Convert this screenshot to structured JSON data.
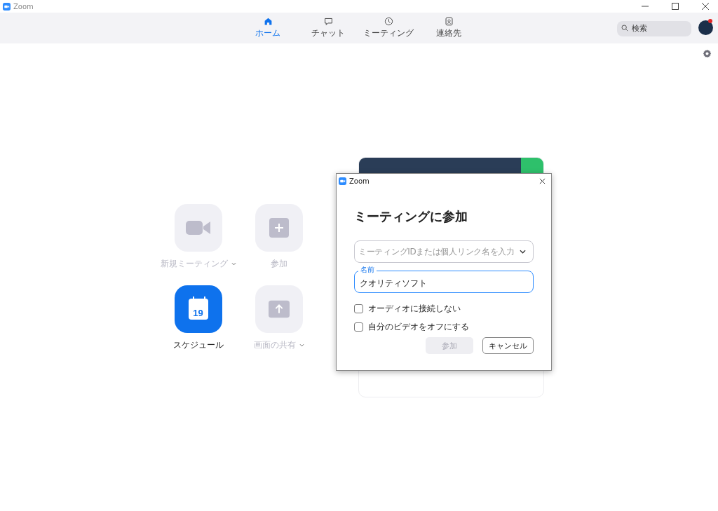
{
  "window": {
    "title": "Zoom"
  },
  "nav": {
    "tabs": [
      {
        "label": "ホーム",
        "selected": true
      },
      {
        "label": "チャット",
        "selected": false
      },
      {
        "label": "ミーティング",
        "selected": false
      },
      {
        "label": "連絡先",
        "selected": false
      }
    ],
    "search": {
      "placeholder": "検索"
    }
  },
  "actions": [
    {
      "label": "新規ミーティング",
      "disabled": true,
      "has_menu": true
    },
    {
      "label": "参加",
      "disabled": true,
      "has_menu": false
    },
    {
      "label": "スケジュール",
      "disabled": false,
      "has_menu": false,
      "icon_text": "19"
    },
    {
      "label": "画面の共有",
      "disabled": true,
      "has_menu": true
    }
  ],
  "dialog": {
    "title": "Zoom",
    "heading": "ミーティングに参加",
    "meeting_id": {
      "placeholder": "ミーティングIDまたは個人リンク名を入力"
    },
    "name": {
      "label": "名前",
      "value": "クオリティソフト"
    },
    "options": [
      {
        "label": "オーディオに接続しない",
        "checked": false
      },
      {
        "label": "自分のビデオをオフにする",
        "checked": false
      }
    ],
    "buttons": [
      {
        "label": "参加",
        "kind": "primary",
        "disabled": true
      },
      {
        "label": "キャンセル",
        "kind": "secondary",
        "disabled": false
      }
    ]
  }
}
